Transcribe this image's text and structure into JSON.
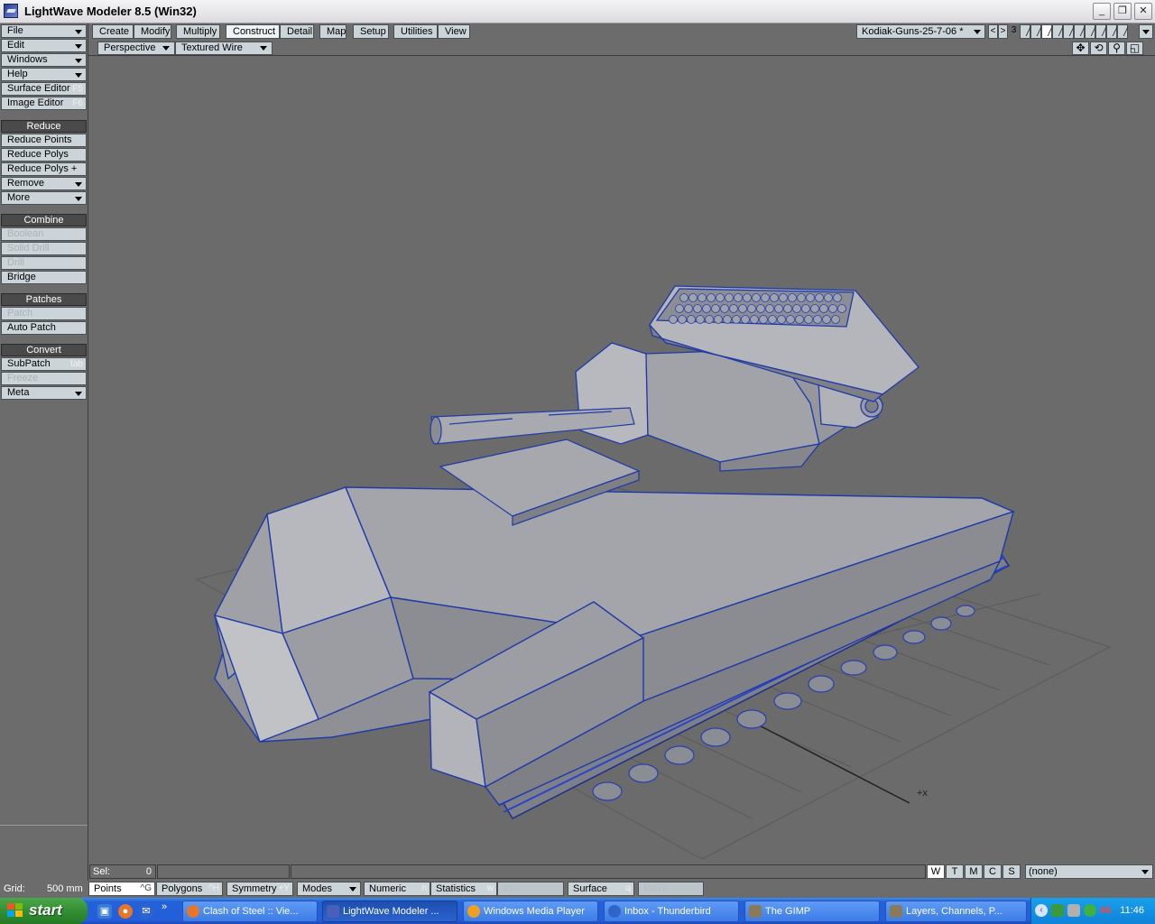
{
  "window": {
    "title": "LightWave Modeler 8.5 (Win32)",
    "min": "_",
    "max": "❐",
    "close": "✕"
  },
  "left_panel": {
    "top_menus": [
      {
        "label": "File",
        "dropdown": true
      },
      {
        "label": "Edit",
        "dropdown": true
      },
      {
        "label": "Windows",
        "dropdown": true
      },
      {
        "label": "Help",
        "dropdown": true
      },
      {
        "label": "Surface Editor",
        "shortcut": "F5"
      },
      {
        "label": "Image Editor",
        "shortcut": "F6"
      }
    ],
    "reduce": {
      "header": "Reduce",
      "items": [
        "Reduce Points",
        "Reduce Polys",
        "Reduce Polys +",
        "Remove",
        "More"
      ]
    },
    "combine": {
      "header": "Combine",
      "items": [
        "Boolean",
        "Solid Drill",
        "Drill",
        "Bridge"
      ]
    },
    "patches": {
      "header": "Patches",
      "items": [
        "Patch",
        "Auto Patch"
      ]
    },
    "convert": {
      "header": "Convert",
      "items": [
        "SubPatch",
        "Freeze",
        "Meta"
      ],
      "subpatch_shortcut": "tab"
    }
  },
  "tabs": [
    "Create",
    "Modify",
    "Multiply",
    "Construct",
    "Detail",
    "Map",
    "Setup",
    "Utilities",
    "View"
  ],
  "active_tab": "Construct",
  "object_select": "Kodiak-Guns-25-7-06 *",
  "layer_nav": {
    "prev": "<",
    "next": ">",
    "bank": "3"
  },
  "viewport": {
    "view_type": "Perspective",
    "render_mode": "Textured Wire",
    "icons": [
      "move-view",
      "rotate-view",
      "zoom-view",
      "maximize-view"
    ]
  },
  "status": {
    "sel_label": "Sel:",
    "sel_value": "0",
    "wtmcs": [
      "W",
      "T",
      "M",
      "C",
      "S"
    ],
    "surface_value": "(none)"
  },
  "bottom": {
    "grid_label": "Grid:",
    "grid_value": "500 mm",
    "points": "Points",
    "points_sc": "^G",
    "polygons": "Polygons",
    "polygons_sc": "^H",
    "symmetry": "Symmetry",
    "symmetry_sc": "+Y",
    "modes": "Modes",
    "numeric": "Numeric",
    "numeric_sc": "n",
    "statistics": "Statistics",
    "statistics_sc": "w",
    "info": "Info",
    "surface": "Surface",
    "surface_sc": "q",
    "make": "Make"
  },
  "taskbar": {
    "start": "start",
    "tasks": [
      "Clash of Steel :: Vie...",
      "LightWave Modeler ...",
      "Windows Media Player",
      "Inbox - Thunderbird",
      "The GIMP",
      "Layers, Channels, P..."
    ],
    "active_task": "LightWave Modeler ...",
    "tray_count": "46",
    "clock": "11:46"
  }
}
